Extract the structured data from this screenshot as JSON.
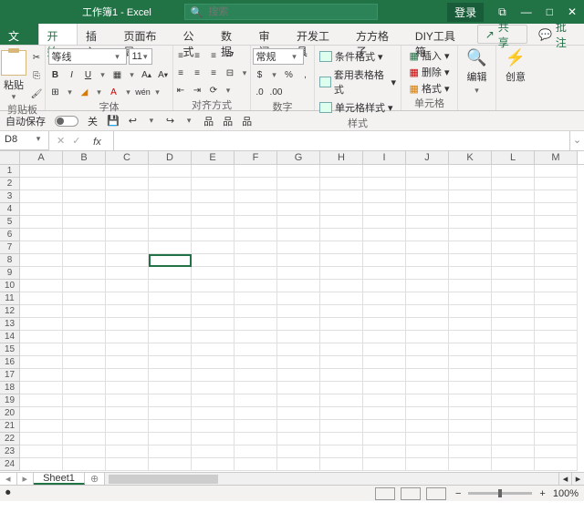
{
  "title": {
    "doc": "工作簿1",
    "app": "Excel"
  },
  "search": {
    "placeholder": "搜索"
  },
  "win": {
    "login": "登录",
    "restore": "⧉",
    "min": "—",
    "max": "□",
    "close": "✕"
  },
  "tabs": {
    "file": "文件",
    "home": "开始",
    "insert": "插入",
    "layout": "页面布局",
    "formulas": "公式",
    "data": "数据",
    "review": "审阅",
    "dev": "开发工具",
    "ff": "方方格子",
    "diy": "DIY工具箱"
  },
  "share": {
    "share": "共享",
    "comment": "批注"
  },
  "ribbon": {
    "clipboard": {
      "paste": "粘贴",
      "label": "剪贴板"
    },
    "font": {
      "name": "等线",
      "size": "11",
      "b": "B",
      "i": "I",
      "u": "U",
      "wen": "wén",
      "label": "字体"
    },
    "align": {
      "label": "对齐方式"
    },
    "number": {
      "label": "数字",
      "fmt": "常规"
    },
    "styles": {
      "cond": "条件格式",
      "tbl": "套用表格格式",
      "cell": "单元格样式",
      "label": "样式"
    },
    "cells": {
      "insert": "插入",
      "delete": "删除",
      "format": "格式",
      "label": "单元格"
    },
    "editing": {
      "label": "编辑"
    },
    "ideas": {
      "label": "创意"
    }
  },
  "qat": {
    "autosave": "自动保存",
    "off": "关"
  },
  "cellref": "D8",
  "columns": [
    "A",
    "B",
    "C",
    "D",
    "E",
    "F",
    "G",
    "H",
    "I",
    "J",
    "K",
    "L",
    "M"
  ],
  "rows": [
    1,
    2,
    3,
    4,
    5,
    6,
    7,
    8,
    9,
    10,
    11,
    12,
    13,
    14,
    15,
    16,
    17,
    18,
    19,
    20,
    21,
    22,
    23,
    24
  ],
  "sheet": "Sheet1",
  "status": {
    "zoom": "100%"
  }
}
